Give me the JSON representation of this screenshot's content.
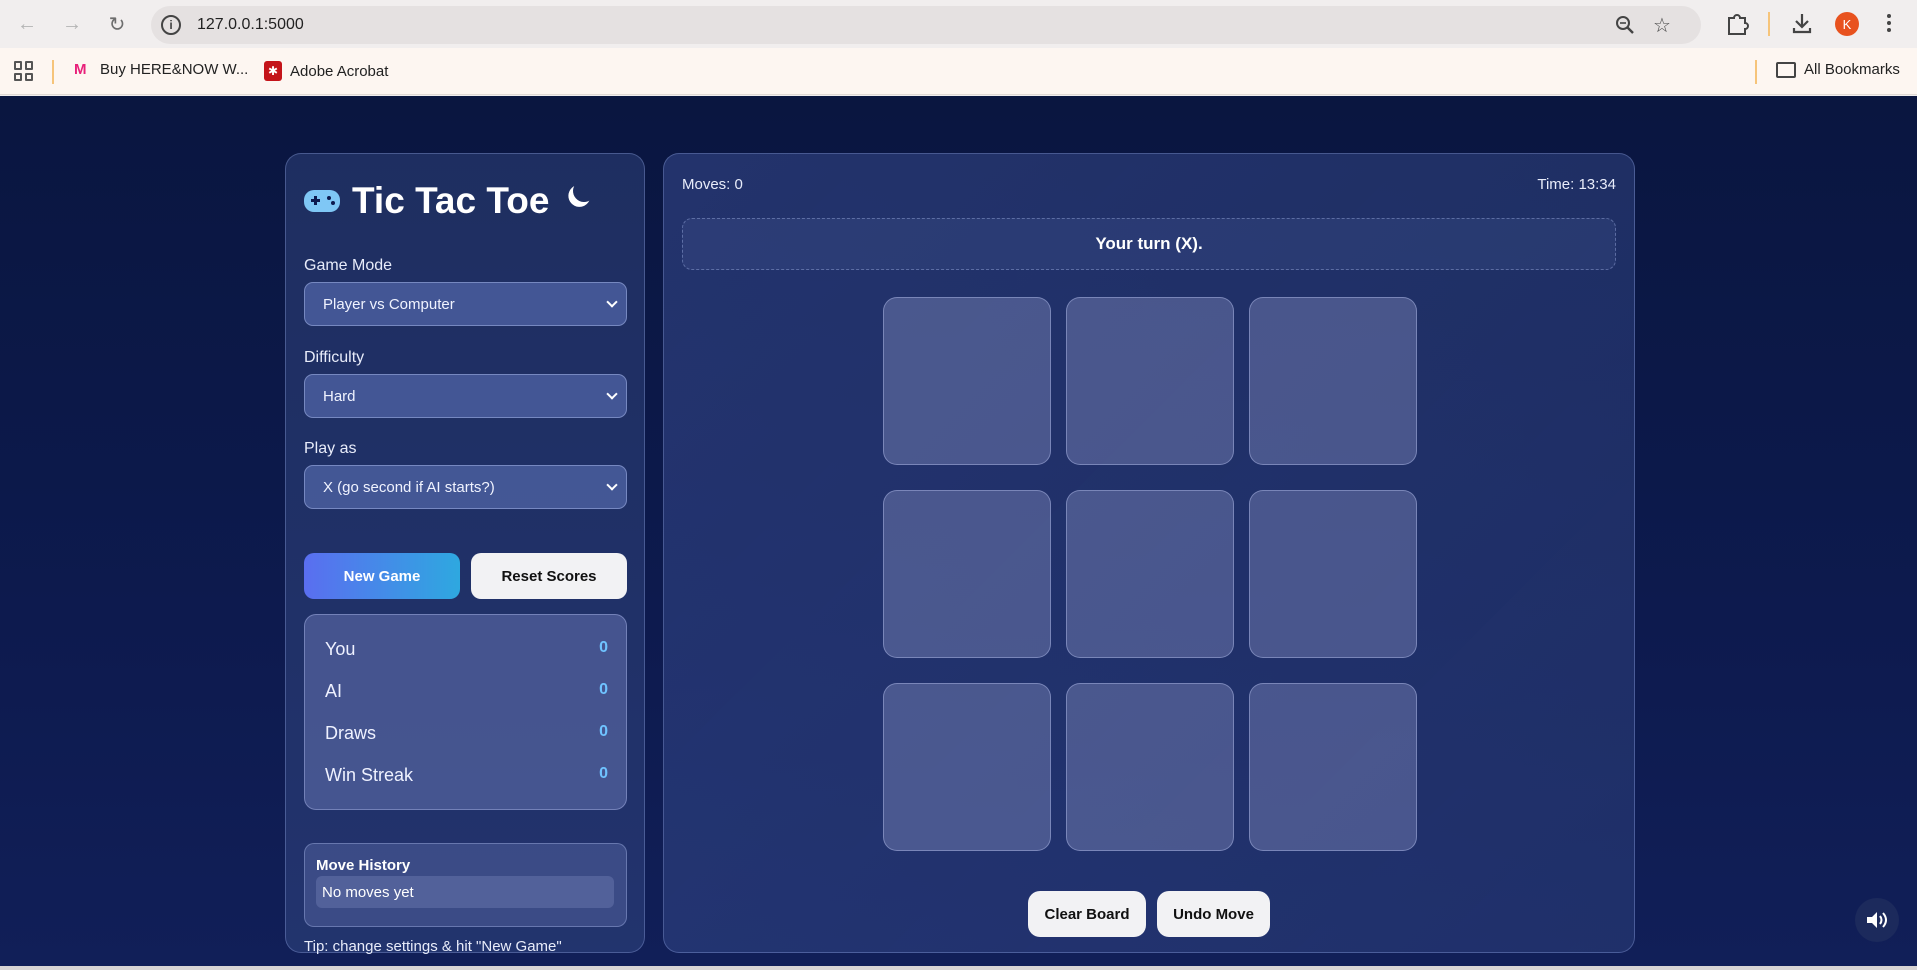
{
  "browser": {
    "url": "127.0.0.1:5000",
    "avatar_letter": "K",
    "bookmarks": [
      {
        "label": "Buy HERE&NOW W..."
      },
      {
        "label": "Adobe Acrobat"
      }
    ],
    "all_bookmarks_label": "All Bookmarks"
  },
  "app": {
    "title": "Tic Tac Toe",
    "game_mode": {
      "label": "Game Mode",
      "value": "Player vs Computer"
    },
    "difficulty": {
      "label": "Difficulty",
      "value": "Hard"
    },
    "play_as": {
      "label": "Play as",
      "value": "X (go second if AI starts?)"
    },
    "new_game_label": "New Game",
    "reset_scores_label": "Reset Scores",
    "scores": [
      {
        "label": "You",
        "value": "0"
      },
      {
        "label": "AI",
        "value": "0"
      },
      {
        "label": "Draws",
        "value": "0"
      },
      {
        "label": "Win Streak",
        "value": "0"
      }
    ],
    "history": {
      "title": "Move History",
      "empty": "No moves yet"
    },
    "tip": "Tip: change settings & hit \"New Game\""
  },
  "game": {
    "moves": "Moves: 0",
    "time": "Time: 13:34",
    "status": "Your turn (X).",
    "board": [
      "",
      "",
      "",
      "",
      "",
      "",
      "",
      "",
      ""
    ],
    "clear_label": "Clear Board",
    "undo_label": "Undo Move"
  },
  "colors": {
    "accent_start": "#5a6ef0",
    "accent_end": "#2ea8e0",
    "score_value": "#6fc3ff",
    "background": "#0d1a4e"
  }
}
